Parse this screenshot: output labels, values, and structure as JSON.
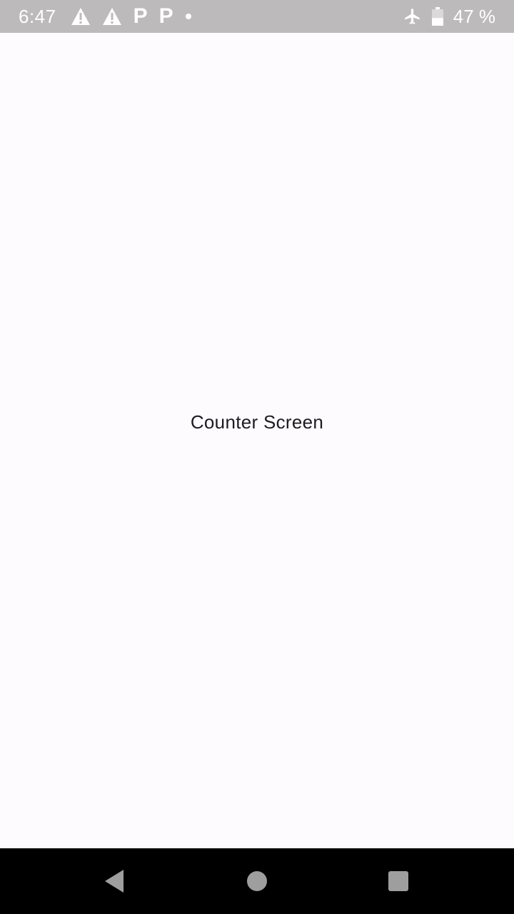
{
  "status_bar": {
    "time": "6:47",
    "notification_icons": [
      "warning-icon",
      "warning-icon",
      "parking-icon",
      "parking-icon",
      "dot-icon"
    ],
    "parking_glyph": "P",
    "system_icons": [
      "airplane-mode-icon",
      "battery-icon"
    ],
    "battery_percent": "47 %",
    "battery_level": 0.47
  },
  "main": {
    "label": "Counter Screen"
  },
  "nav_bar": {
    "buttons": [
      "back",
      "home",
      "recents"
    ]
  },
  "colors": {
    "status_bar_bg": "#bdbabb",
    "background": "#fdfbfe",
    "text": "#1d1b20",
    "nav_bar_bg": "#000000",
    "nav_icon": "#9e9e9e"
  }
}
